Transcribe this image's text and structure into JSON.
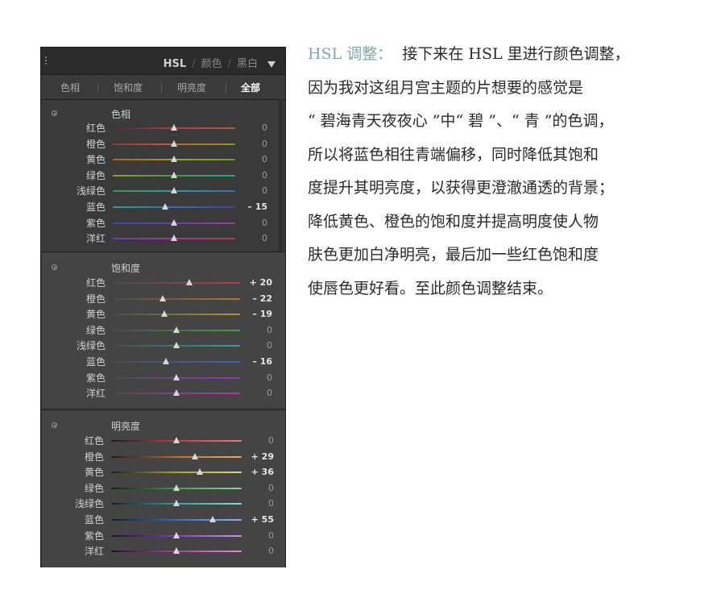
{
  "panel": {
    "top_menu": [
      "HSL",
      "颜色",
      "黑白"
    ],
    "tabs": [
      "色相",
      "饱和度",
      "明亮度",
      "全部"
    ],
    "active_tab": "全部"
  },
  "sections": [
    {
      "title": "色相",
      "rows": [
        {
          "label": "红色",
          "value": 0,
          "display": "0",
          "track": "linear-gradient(90deg,#4a2a32,#a8414d,#a85e3f)"
        },
        {
          "label": "橙色",
          "value": 0,
          "display": "0",
          "track": "linear-gradient(90deg,#8a3d36,#b36a34,#a38a31)"
        },
        {
          "label": "黄色",
          "value": 0,
          "display": "0",
          "track": "linear-gradient(90deg,#a3672e,#a19a30,#6f9a35)"
        },
        {
          "label": "绿色",
          "value": 0,
          "display": "0",
          "track": "linear-gradient(90deg,#8f9b32,#3f9a45,#2f9b86)"
        },
        {
          "label": "浅绿色",
          "value": 0,
          "display": "0",
          "track": "linear-gradient(90deg,#3a9a52,#2e9aa0,#3a6fb0)"
        },
        {
          "label": "蓝色",
          "value": -15,
          "display": "– 15",
          "track": "linear-gradient(90deg,#2fa08f,#3170b2,#4a3cb0)"
        },
        {
          "label": "紫色",
          "value": 0,
          "display": "0",
          "track": "linear-gradient(90deg,#3b4ab5,#6a3bb0,#a03aa8)"
        },
        {
          "label": "洋红",
          "value": 0,
          "display": "0",
          "track": "linear-gradient(90deg,#6d3cb2,#a8389a,#a8414f)"
        }
      ]
    },
    {
      "title": "饱和度",
      "rows": [
        {
          "label": "红色",
          "value": 20,
          "display": "+ 20",
          "track": "linear-gradient(90deg,#4a4a4a,#b0424e)"
        },
        {
          "label": "橙色",
          "value": -22,
          "display": "– 22",
          "track": "linear-gradient(90deg,#4a4a4a,#b5722f)"
        },
        {
          "label": "黄色",
          "value": -19,
          "display": "– 19",
          "track": "linear-gradient(90deg,#4a4a4a,#a99d2d)"
        },
        {
          "label": "绿色",
          "value": 0,
          "display": "0",
          "track": "linear-gradient(90deg,#4a4a4a,#3fa046)"
        },
        {
          "label": "浅绿色",
          "value": 0,
          "display": "0",
          "track": "linear-gradient(90deg,#4a4a4a,#2ea1a4)"
        },
        {
          "label": "蓝色",
          "value": -16,
          "display": "– 16",
          "track": "linear-gradient(90deg,#4a4a4a,#3a66c2)"
        },
        {
          "label": "紫色",
          "value": 0,
          "display": "0",
          "track": "linear-gradient(90deg,#4a4a4a,#8a3cc0)"
        },
        {
          "label": "洋红",
          "value": 0,
          "display": "0",
          "track": "linear-gradient(90deg,#4a4a4a,#b23aa2)"
        }
      ]
    },
    {
      "title": "明亮度",
      "rows": [
        {
          "label": "红色",
          "value": 0,
          "display": "0",
          "track": "linear-gradient(90deg,#2a1416,#b6404c,#e07c84)"
        },
        {
          "label": "橙色",
          "value": 29,
          "display": "+ 29",
          "track": "linear-gradient(90deg,#2a1a0e,#b8702e,#e6a86a)"
        },
        {
          "label": "黄色",
          "value": 36,
          "display": "+ 36",
          "track": "linear-gradient(90deg,#26230c,#aba02c,#e2d878)"
        },
        {
          "label": "绿色",
          "value": 0,
          "display": "0",
          "track": "linear-gradient(90deg,#0f2412,#3fa046,#8ed894)"
        },
        {
          "label": "浅绿色",
          "value": 0,
          "display": "0",
          "track": "linear-gradient(90deg,#0d2426,#2ea1a4,#86dcde)"
        },
        {
          "label": "蓝色",
          "value": 55,
          "display": "+ 55",
          "track": "linear-gradient(90deg,#0f1a2e,#3a6cc2,#8fb6ec)"
        },
        {
          "label": "紫色",
          "value": 0,
          "display": "0",
          "track": "linear-gradient(90deg,#1e0f2c,#8a3cc0,#c89ae6)"
        },
        {
          "label": "洋红",
          "value": 0,
          "display": "0",
          "track": "linear-gradient(90deg,#2a0f26,#b23aa2,#e68ad8)"
        }
      ]
    }
  ],
  "article": {
    "heading": "HSL 调整：",
    "lines": [
      "接下来在 HSL 里进行颜色调整，",
      "因为我对这组月宫主题的片想要的感觉是",
      "“ 碧海青天夜夜心 ”中“ 碧 ”、“ 青 ”的色调，",
      "所以将蓝色相往青端偏移，同时降低其饱和",
      "度提升其明亮度，以获得更澄澈通透的背景；",
      "降低黄色、橙色的饱和度并提高明度使人物",
      "肤色更加白净明亮，最后加一些红色饱和度",
      "使唇色更好看。至此颜色调整结束。"
    ]
  }
}
